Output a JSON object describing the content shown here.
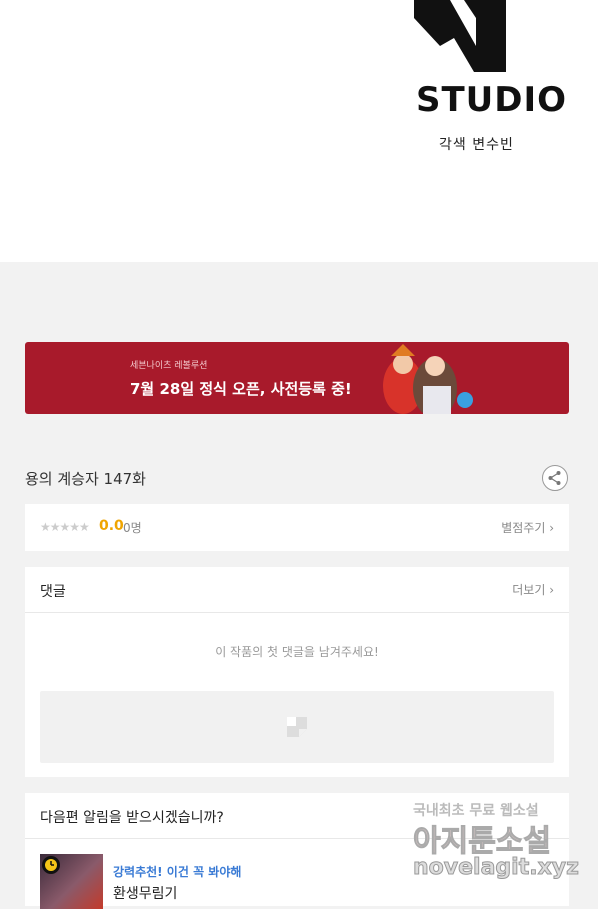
{
  "top": {
    "logo_text": "STUDIO",
    "credit": "각색 변수빈"
  },
  "banner": {
    "subtitle": "세븐나이츠 레볼루션",
    "title": "7월 28일 정식 오픈, 사전등록 중!"
  },
  "episode": {
    "title": "용의 계승자 147화"
  },
  "rating": {
    "stars": "★★★★★",
    "score": "0.0",
    "count": "0명",
    "rate_label": "별점주기 ›"
  },
  "comments": {
    "heading": "댓글",
    "more_label": "더보기 ›",
    "empty_message": "이 작품의 첫 댓글을 남겨주세요!"
  },
  "notify": {
    "heading": "다음편 알림을 받으시겠습니까?",
    "recommend_tag": "강력추천! 이건 꼭 봐야해",
    "recommend_title": "환생무림기"
  },
  "watermark": {
    "line1": "국내최초 무료 웹소설",
    "line2": "아지툰소설",
    "line3": "novelagit.xyz"
  },
  "colors": {
    "banner_bg": "#a81a2b",
    "score": "#f0a500",
    "recommend_tag": "#3a7bd5"
  }
}
